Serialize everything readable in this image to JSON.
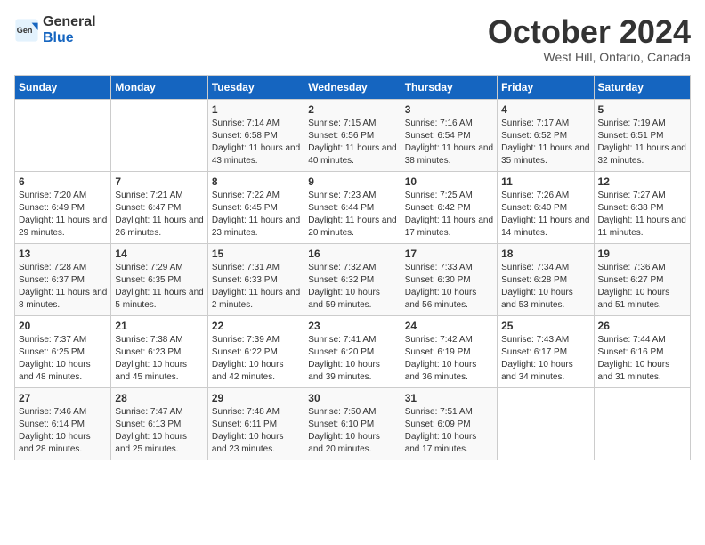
{
  "logo": {
    "general": "General",
    "blue": "Blue"
  },
  "header": {
    "month": "October 2024",
    "location": "West Hill, Ontario, Canada"
  },
  "days_of_week": [
    "Sunday",
    "Monday",
    "Tuesday",
    "Wednesday",
    "Thursday",
    "Friday",
    "Saturday"
  ],
  "weeks": [
    [
      {
        "day": "",
        "content": ""
      },
      {
        "day": "",
        "content": ""
      },
      {
        "day": "1",
        "content": "Sunrise: 7:14 AM\nSunset: 6:58 PM\nDaylight: 11 hours and 43 minutes."
      },
      {
        "day": "2",
        "content": "Sunrise: 7:15 AM\nSunset: 6:56 PM\nDaylight: 11 hours and 40 minutes."
      },
      {
        "day": "3",
        "content": "Sunrise: 7:16 AM\nSunset: 6:54 PM\nDaylight: 11 hours and 38 minutes."
      },
      {
        "day": "4",
        "content": "Sunrise: 7:17 AM\nSunset: 6:52 PM\nDaylight: 11 hours and 35 minutes."
      },
      {
        "day": "5",
        "content": "Sunrise: 7:19 AM\nSunset: 6:51 PM\nDaylight: 11 hours and 32 minutes."
      }
    ],
    [
      {
        "day": "6",
        "content": "Sunrise: 7:20 AM\nSunset: 6:49 PM\nDaylight: 11 hours and 29 minutes."
      },
      {
        "day": "7",
        "content": "Sunrise: 7:21 AM\nSunset: 6:47 PM\nDaylight: 11 hours and 26 minutes."
      },
      {
        "day": "8",
        "content": "Sunrise: 7:22 AM\nSunset: 6:45 PM\nDaylight: 11 hours and 23 minutes."
      },
      {
        "day": "9",
        "content": "Sunrise: 7:23 AM\nSunset: 6:44 PM\nDaylight: 11 hours and 20 minutes."
      },
      {
        "day": "10",
        "content": "Sunrise: 7:25 AM\nSunset: 6:42 PM\nDaylight: 11 hours and 17 minutes."
      },
      {
        "day": "11",
        "content": "Sunrise: 7:26 AM\nSunset: 6:40 PM\nDaylight: 11 hours and 14 minutes."
      },
      {
        "day": "12",
        "content": "Sunrise: 7:27 AM\nSunset: 6:38 PM\nDaylight: 11 hours and 11 minutes."
      }
    ],
    [
      {
        "day": "13",
        "content": "Sunrise: 7:28 AM\nSunset: 6:37 PM\nDaylight: 11 hours and 8 minutes."
      },
      {
        "day": "14",
        "content": "Sunrise: 7:29 AM\nSunset: 6:35 PM\nDaylight: 11 hours and 5 minutes."
      },
      {
        "day": "15",
        "content": "Sunrise: 7:31 AM\nSunset: 6:33 PM\nDaylight: 11 hours and 2 minutes."
      },
      {
        "day": "16",
        "content": "Sunrise: 7:32 AM\nSunset: 6:32 PM\nDaylight: 10 hours and 59 minutes."
      },
      {
        "day": "17",
        "content": "Sunrise: 7:33 AM\nSunset: 6:30 PM\nDaylight: 10 hours and 56 minutes."
      },
      {
        "day": "18",
        "content": "Sunrise: 7:34 AM\nSunset: 6:28 PM\nDaylight: 10 hours and 53 minutes."
      },
      {
        "day": "19",
        "content": "Sunrise: 7:36 AM\nSunset: 6:27 PM\nDaylight: 10 hours and 51 minutes."
      }
    ],
    [
      {
        "day": "20",
        "content": "Sunrise: 7:37 AM\nSunset: 6:25 PM\nDaylight: 10 hours and 48 minutes."
      },
      {
        "day": "21",
        "content": "Sunrise: 7:38 AM\nSunset: 6:23 PM\nDaylight: 10 hours and 45 minutes."
      },
      {
        "day": "22",
        "content": "Sunrise: 7:39 AM\nSunset: 6:22 PM\nDaylight: 10 hours and 42 minutes."
      },
      {
        "day": "23",
        "content": "Sunrise: 7:41 AM\nSunset: 6:20 PM\nDaylight: 10 hours and 39 minutes."
      },
      {
        "day": "24",
        "content": "Sunrise: 7:42 AM\nSunset: 6:19 PM\nDaylight: 10 hours and 36 minutes."
      },
      {
        "day": "25",
        "content": "Sunrise: 7:43 AM\nSunset: 6:17 PM\nDaylight: 10 hours and 34 minutes."
      },
      {
        "day": "26",
        "content": "Sunrise: 7:44 AM\nSunset: 6:16 PM\nDaylight: 10 hours and 31 minutes."
      }
    ],
    [
      {
        "day": "27",
        "content": "Sunrise: 7:46 AM\nSunset: 6:14 PM\nDaylight: 10 hours and 28 minutes."
      },
      {
        "day": "28",
        "content": "Sunrise: 7:47 AM\nSunset: 6:13 PM\nDaylight: 10 hours and 25 minutes."
      },
      {
        "day": "29",
        "content": "Sunrise: 7:48 AM\nSunset: 6:11 PM\nDaylight: 10 hours and 23 minutes."
      },
      {
        "day": "30",
        "content": "Sunrise: 7:50 AM\nSunset: 6:10 PM\nDaylight: 10 hours and 20 minutes."
      },
      {
        "day": "31",
        "content": "Sunrise: 7:51 AM\nSunset: 6:09 PM\nDaylight: 10 hours and 17 minutes."
      },
      {
        "day": "",
        "content": ""
      },
      {
        "day": "",
        "content": ""
      }
    ]
  ]
}
